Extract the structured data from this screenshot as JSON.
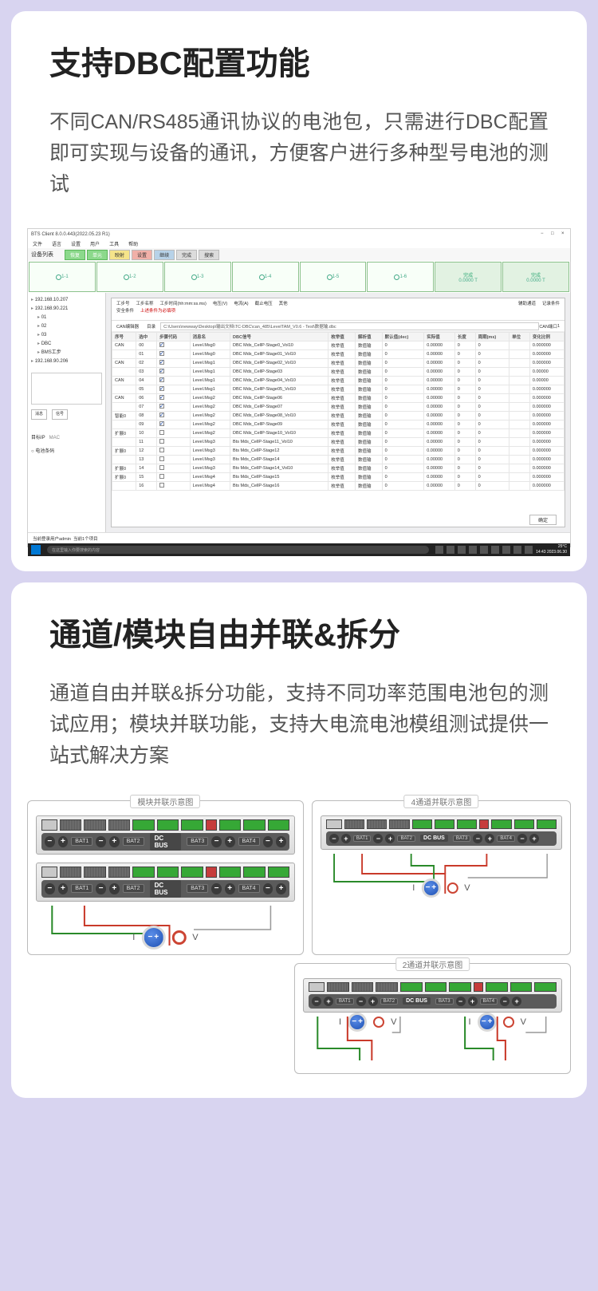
{
  "section1": {
    "title": "支持DBC配置功能",
    "desc": "不同CAN/RS485通讯协议的电池包，只需进行DBC配置即可实现与设备的通讯，方便客户进行多种型号电池的测试",
    "app": {
      "title": "BTS Client 8.0.0.443(2022.05.23 R1)",
      "menu": [
        "文件",
        "语言",
        "设置",
        "用户",
        "工具",
        "帮助"
      ],
      "side_label": "设备列表",
      "buttons": [
        "恢复",
        "单元",
        "映射",
        "设置",
        "继续",
        "完成",
        "搜索"
      ],
      "tree": [
        "192.168.10.207",
        "192.168.90.221",
        "01",
        "02",
        "03",
        "DBC",
        "BMS工步",
        "192.168.90.206"
      ],
      "tree_panel_btns": [
        "消息",
        "信号"
      ],
      "tree_tab": "目标IP",
      "tree_radio": "电池条码",
      "headrow": [
        "工步号",
        "工步名称",
        "工步时间(hh:mm:ss.ms)",
        "电压(V)",
        "电流(A)",
        "截止电压",
        "其他",
        "辅助通道",
        "记录条件"
      ],
      "headrow2_a": "安全条件",
      "headrow2_b": "上述条件为必填项",
      "browse_label": "CAN编辑器",
      "path_label": "目录",
      "path_value": "C:\\Users\\newway\\Desktop\\输出文档\\TC-DBC\\can_485\\LevelTAM_V0.6 - Test\\数据输.dbc",
      "table_head": [
        "序号",
        "选中",
        "步骤代码",
        "消息名",
        "DBC信号",
        "枚举值",
        "解析值",
        "默认值(dec)",
        "实际值",
        "长度",
        "周期(ms)",
        "单位",
        "变化比例"
      ],
      "rows": [
        {
          "cat": "CAN",
          "idx": "00",
          "ck": true,
          "code": "Level.Msg0",
          "sig": "DBC Mds_CellP-Stage0_Vol10",
          "enu": "枚举值",
          "par": "数值输",
          "def": "0",
          "act": "0.00000",
          "len": "0",
          "per": "0",
          "unit": "",
          "scale": "0.000000"
        },
        {
          "cat": "",
          "idx": "01",
          "ck": true,
          "code": "Level.Msg0",
          "sig": "DBC Mds_CellP-Stage01_Vol10",
          "enu": "枚举值",
          "par": "数值输",
          "def": "0",
          "act": "0.00000",
          "len": "0",
          "per": "0",
          "unit": "",
          "scale": "0.000000"
        },
        {
          "cat": "CAN",
          "idx": "02",
          "ck": true,
          "code": "Level.Msg1",
          "sig": "DBC Mds_CellP-Stage02_Vol10",
          "enu": "枚举值",
          "par": "数值输",
          "def": "0",
          "act": "0.00000",
          "len": "0",
          "per": "0",
          "unit": "",
          "scale": "0.000000"
        },
        {
          "cat": "",
          "idx": "03",
          "ck": true,
          "code": "Level.Msg1",
          "sig": "DBC Mds_CellP-Stage03",
          "enu": "枚举值",
          "par": "数值输",
          "def": "0",
          "act": "0.00000",
          "len": "0",
          "per": "0",
          "unit": "",
          "scale": "0.00000"
        },
        {
          "cat": "CAN",
          "idx": "04",
          "ck": true,
          "code": "Level.Msg1",
          "sig": "DBC Mds_CellP-Stage04_Vol10",
          "enu": "枚举值",
          "par": "数值输",
          "def": "0",
          "act": "0.00000",
          "len": "0",
          "per": "0",
          "unit": "",
          "scale": "0.00000"
        },
        {
          "cat": "",
          "idx": "05",
          "ck": true,
          "code": "Level.Msg1",
          "sig": "DBC Mds_CellP-Stage05_Vol10",
          "enu": "枚举值",
          "par": "数值输",
          "def": "0",
          "act": "0.00000",
          "len": "0",
          "per": "0",
          "unit": "",
          "scale": "0.000000"
        },
        {
          "cat": "CAN",
          "idx": "06",
          "ck": true,
          "code": "Level.Msg2",
          "sig": "DBC Mds_CellP-Stage06",
          "enu": "枚举值",
          "par": "数值输",
          "def": "0",
          "act": "0.00000",
          "len": "0",
          "per": "0",
          "unit": "",
          "scale": "0.000000"
        },
        {
          "cat": "",
          "idx": "07",
          "ck": true,
          "code": "Level.Msg2",
          "sig": "DBC Mds_CellP-Stage07",
          "enu": "枚举值",
          "par": "数值输",
          "def": "0",
          "act": "0.00000",
          "len": "0",
          "per": "0",
          "unit": "",
          "scale": "0.000000"
        },
        {
          "cat": "智能0",
          "idx": "08",
          "ck": true,
          "code": "Level.Msg2",
          "sig": "DBC Mds_CellP-Stage08_Vol10",
          "enu": "枚举值",
          "par": "数值输",
          "def": "0",
          "act": "0.00000",
          "len": "0",
          "per": "0",
          "unit": "",
          "scale": "0.000000"
        },
        {
          "cat": "",
          "idx": "09",
          "ck": true,
          "code": "Level.Msg2",
          "sig": "DBC Mds_CellP-Stage09",
          "enu": "枚举值",
          "par": "数值输",
          "def": "0",
          "act": "0.00000",
          "len": "0",
          "per": "0",
          "unit": "",
          "scale": "0.000000"
        },
        {
          "cat": "扩展0",
          "idx": "10",
          "ck": false,
          "code": "Level.Msg2",
          "sig": "DBC Mds_CellP-Stage10_Vol10",
          "enu": "枚举值",
          "par": "数值输",
          "def": "0",
          "act": "0.00000",
          "len": "0",
          "per": "0",
          "unit": "",
          "scale": "0.000000"
        },
        {
          "cat": "",
          "idx": "11",
          "ck": false,
          "code": "Level.Msg3",
          "sig": "Bts Mds_CellP-Stage11_Vol10",
          "enu": "枚举值",
          "par": "数值输",
          "def": "0",
          "act": "0.00000",
          "len": "0",
          "per": "0",
          "unit": "",
          "scale": "0.000000"
        },
        {
          "cat": "扩展0",
          "idx": "12",
          "ck": false,
          "code": "Level.Msg3",
          "sig": "Bts Mds_CellP-Stage12",
          "enu": "枚举值",
          "par": "数值输",
          "def": "0",
          "act": "0.00000",
          "len": "0",
          "per": "0",
          "unit": "",
          "scale": "0.000000"
        },
        {
          "cat": "",
          "idx": "13",
          "ck": false,
          "code": "Level.Msg3",
          "sig": "Bts Mds_CellP-Stage14",
          "enu": "枚举值",
          "par": "数值输",
          "def": "0",
          "act": "0.00000",
          "len": "0",
          "per": "0",
          "unit": "",
          "scale": "0.000000"
        },
        {
          "cat": "扩展0",
          "idx": "14",
          "ck": false,
          "code": "Level.Msg3",
          "sig": "Bts Mds_CellP-Stage14_Vol10",
          "enu": "枚举值",
          "par": "数值输",
          "def": "0",
          "act": "0.00000",
          "len": "0",
          "per": "0",
          "unit": "",
          "scale": "0.000000"
        },
        {
          "cat": "扩展0",
          "idx": "15",
          "ck": false,
          "code": "Level.Msg4",
          "sig": "Bts Mds_CellP-Stage15",
          "enu": "枚举值",
          "par": "数值输",
          "def": "0",
          "act": "0.00000",
          "len": "0",
          "per": "0",
          "unit": "",
          "scale": "0.000000"
        },
        {
          "cat": "",
          "idx": "16",
          "ck": false,
          "code": "Level.Msg4",
          "sig": "Bts Mds_CellP-Stage16",
          "enu": "枚举值",
          "par": "数值输",
          "def": "0",
          "act": "0.00000",
          "len": "0",
          "per": "0",
          "unit": "",
          "scale": "0.000000"
        }
      ],
      "ok_btn": "确定",
      "status_left": "当前登录用户admin",
      "status_right": "当前1个项目",
      "search_placeholder": "在这里输入你要搜索的内容",
      "temp": "25°C",
      "time": "14:43",
      "date": "2023.06.30",
      "channel_footer": "0.0000 T",
      "channel_done_val": "0.0000 T",
      "can_port_label": "CAN端口"
    }
  },
  "section2": {
    "title": "通道/模块自由并联&拆分",
    "desc": "通道自由并联&拆分功能，支持不同功率范围电池包的测试应用；模块并联功能，支持大电流电池模组测试提供一站式解决方案",
    "panel_module": "模块并联示意图",
    "panel_4ch": "4通道并联示意图",
    "panel_2ch": "2通道并联示意图",
    "bat": [
      "BAT1",
      "BAT2",
      "BAT3",
      "BAT4"
    ],
    "dcbus": "DC BUS",
    "I": "I",
    "V": "V",
    "minus": "−",
    "plus": "+"
  }
}
